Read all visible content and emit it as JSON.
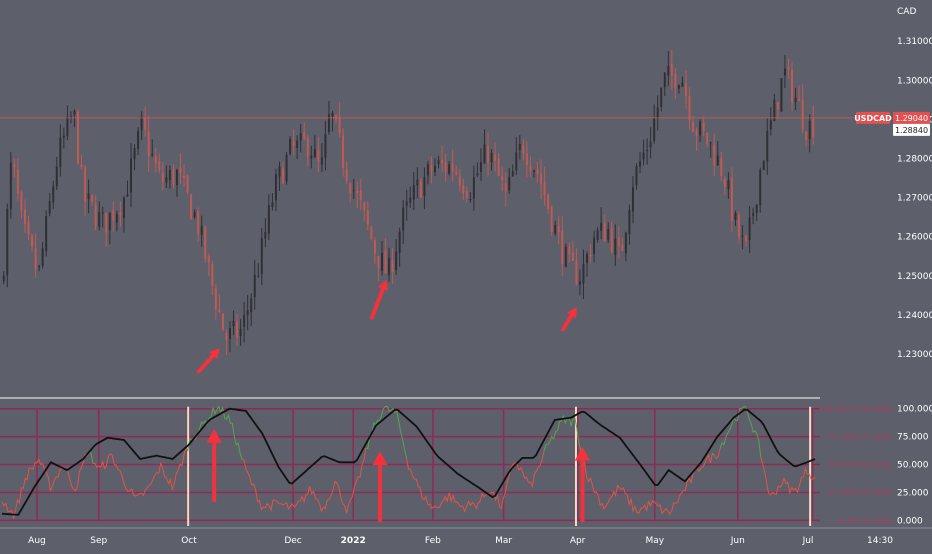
{
  "chart_data": [
    {
      "type": "candlestick",
      "symbol": "USDCAD",
      "currency_label": "CAD",
      "y_ticks": [
        1.23,
        1.24,
        1.25,
        1.26,
        1.27,
        1.28,
        1.29,
        1.3,
        1.31
      ],
      "y_tick_labels": [
        "1.23000",
        "1.24000",
        "1.25000",
        "1.26000",
        "1.27000",
        "1.28000",
        "1.29000",
        "1.30000",
        "1.31000"
      ],
      "ylim": [
        1.2195,
        1.3185
      ],
      "x_labels": [
        {
          "label": "Aug",
          "t": 0.043
        },
        {
          "label": "Sep",
          "t": 0.119
        },
        {
          "label": "Oct",
          "t": 0.23
        },
        {
          "label": "Dec",
          "t": 0.358
        },
        {
          "label": "2022",
          "t": 0.432
        },
        {
          "label": "Feb",
          "t": 0.53
        },
        {
          "label": "Mar",
          "t": 0.617
        },
        {
          "label": "Apr",
          "t": 0.708
        },
        {
          "label": "May",
          "t": 0.803
        },
        {
          "label": "Jun",
          "t": 0.905
        },
        {
          "label": "Jul",
          "t": 0.997
        }
      ],
      "anchors": [
        [
          0.0,
          1.248
        ],
        [
          0.012,
          1.28
        ],
        [
          0.025,
          1.262
        ],
        [
          0.045,
          1.25
        ],
        [
          0.068,
          1.28
        ],
        [
          0.088,
          1.292
        ],
        [
          0.1,
          1.27
        ],
        [
          0.125,
          1.263
        ],
        [
          0.15,
          1.27
        ],
        [
          0.172,
          1.288
        ],
        [
          0.195,
          1.274
        ],
        [
          0.215,
          1.276
        ],
        [
          0.24,
          1.264
        ],
        [
          0.258,
          1.248
        ],
        [
          0.275,
          1.234
        ],
        [
          0.295,
          1.236
        ],
        [
          0.315,
          1.252
        ],
        [
          0.335,
          1.272
        ],
        [
          0.355,
          1.282
        ],
        [
          0.378,
          1.284
        ],
        [
          0.392,
          1.276
        ],
        [
          0.404,
          1.292
        ],
        [
          0.422,
          1.278
        ],
        [
          0.44,
          1.268
        ],
        [
          0.46,
          1.256
        ],
        [
          0.475,
          1.25
        ],
        [
          0.492,
          1.264
        ],
        [
          0.51,
          1.272
        ],
        [
          0.532,
          1.278
        ],
        [
          0.555,
          1.278
        ],
        [
          0.575,
          1.272
        ],
        [
          0.598,
          1.282
        ],
        [
          0.62,
          1.27
        ],
        [
          0.64,
          1.284
        ],
        [
          0.66,
          1.276
        ],
        [
          0.68,
          1.262
        ],
        [
          0.697,
          1.252
        ],
        [
          0.712,
          1.25
        ],
        [
          0.728,
          1.26
        ],
        [
          0.745,
          1.262
        ],
        [
          0.76,
          1.254
        ],
        [
          0.775,
          1.274
        ],
        [
          0.795,
          1.284
        ],
        [
          0.815,
          1.3
        ],
        [
          0.835,
          1.302
        ],
        [
          0.852,
          1.288
        ],
        [
          0.87,
          1.284
        ],
        [
          0.888,
          1.276
        ],
        [
          0.903,
          1.262
        ],
        [
          0.915,
          1.256
        ],
        [
          0.935,
          1.28
        ],
        [
          0.95,
          1.292
        ],
        [
          0.962,
          1.302
        ],
        [
          0.975,
          1.296
        ],
        [
          0.99,
          1.288
        ],
        [
          1.0,
          1.289
        ]
      ],
      "last_price": 1.2904,
      "last_price_label": "1.29040",
      "prev_price": 1.2884,
      "prev_price_label": "1.28840",
      "annotations": [
        {
          "type": "arrow",
          "tip": [
            0.268,
            1.2315
          ],
          "tail": [
            0.242,
            1.2255
          ]
        },
        {
          "type": "arrow",
          "tip": [
            0.473,
            1.249
          ],
          "tail": [
            0.455,
            1.2393
          ]
        },
        {
          "type": "arrow",
          "tip": [
            0.707,
            1.242
          ],
          "tail": [
            0.69,
            1.2363
          ]
        }
      ],
      "colors": {
        "up": "#2f2f34",
        "down": "#c05a55",
        "price_line": "#d2595a",
        "badge": "#e0514f",
        "arrow": "#f2323c"
      }
    },
    {
      "type": "line",
      "y_ticks": [
        0,
        25,
        50,
        75,
        100
      ],
      "y_tick_labels": [
        "0.000",
        "25.000",
        "50.000",
        "75.000",
        "100.000"
      ],
      "level_labels": [
        "0.00%(0.000)",
        "25.00%(25.000)",
        "50.00%(50.000)",
        "75.00%(75.000)",
        "100.00%(100.000)"
      ],
      "ylim": [
        -5,
        106
      ],
      "series": [
        {
          "role": "black",
          "color": "#111111",
          "anchors": [
            [
              0.0,
              6
            ],
            [
              0.02,
              5
            ],
            [
              0.04,
              30
            ],
            [
              0.06,
              52
            ],
            [
              0.08,
              45
            ],
            [
              0.1,
              55
            ],
            [
              0.115,
              68
            ],
            [
              0.13,
              74
            ],
            [
              0.15,
              72
            ],
            [
              0.17,
              55
            ],
            [
              0.19,
              58
            ],
            [
              0.21,
              55
            ],
            [
              0.23,
              68
            ],
            [
              0.255,
              90
            ],
            [
              0.28,
              100
            ],
            [
              0.3,
              98
            ],
            [
              0.32,
              78
            ],
            [
              0.34,
              48
            ],
            [
              0.355,
              32
            ],
            [
              0.375,
              45
            ],
            [
              0.395,
              58
            ],
            [
              0.415,
              52
            ],
            [
              0.435,
              52
            ],
            [
              0.46,
              85
            ],
            [
              0.485,
              100
            ],
            [
              0.51,
              84
            ],
            [
              0.535,
              58
            ],
            [
              0.56,
              42
            ],
            [
              0.585,
              30
            ],
            [
              0.605,
              20
            ],
            [
              0.625,
              45
            ],
            [
              0.64,
              56
            ],
            [
              0.655,
              56
            ],
            [
              0.68,
              90
            ],
            [
              0.7,
              92
            ],
            [
              0.715,
              98
            ],
            [
              0.735,
              86
            ],
            [
              0.76,
              74
            ],
            [
              0.785,
              50
            ],
            [
              0.805,
              30
            ],
            [
              0.82,
              45
            ],
            [
              0.84,
              35
            ],
            [
              0.86,
              52
            ],
            [
              0.88,
              75
            ],
            [
              0.9,
              92
            ],
            [
              0.915,
              100
            ],
            [
              0.935,
              88
            ],
            [
              0.955,
              60
            ],
            [
              0.975,
              48
            ],
            [
              0.99,
              52
            ],
            [
              1.0,
              55
            ]
          ]
        },
        {
          "role": "fast",
          "color": "#e05448",
          "highlight_color": "#59a352",
          "highlight_above": 60,
          "anchors": [
            [
              0.0,
              18
            ],
            [
              0.015,
              5
            ],
            [
              0.03,
              40
            ],
            [
              0.045,
              55
            ],
            [
              0.06,
              30
            ],
            [
              0.075,
              50
            ],
            [
              0.09,
              28
            ],
            [
              0.105,
              62
            ],
            [
              0.12,
              45
            ],
            [
              0.135,
              58
            ],
            [
              0.15,
              35
            ],
            [
              0.165,
              18
            ],
            [
              0.18,
              28
            ],
            [
              0.195,
              48
            ],
            [
              0.21,
              30
            ],
            [
              0.23,
              70
            ],
            [
              0.25,
              88
            ],
            [
              0.265,
              102
            ],
            [
              0.28,
              90
            ],
            [
              0.3,
              45
            ],
            [
              0.32,
              12
            ],
            [
              0.34,
              15
            ],
            [
              0.36,
              10
            ],
            [
              0.38,
              28
            ],
            [
              0.395,
              10
            ],
            [
              0.41,
              35
            ],
            [
              0.425,
              8
            ],
            [
              0.44,
              40
            ],
            [
              0.455,
              80
            ],
            [
              0.47,
              101
            ],
            [
              0.485,
              96
            ],
            [
              0.5,
              50
            ],
            [
              0.515,
              25
            ],
            [
              0.53,
              10
            ],
            [
              0.55,
              22
            ],
            [
              0.565,
              12
            ],
            [
              0.585,
              15
            ],
            [
              0.6,
              28
            ],
            [
              0.615,
              12
            ],
            [
              0.63,
              55
            ],
            [
              0.65,
              30
            ],
            [
              0.67,
              65
            ],
            [
              0.69,
              90
            ],
            [
              0.705,
              88
            ],
            [
              0.72,
              40
            ],
            [
              0.74,
              12
            ],
            [
              0.76,
              30
            ],
            [
              0.78,
              8
            ],
            [
              0.8,
              15
            ],
            [
              0.82,
              6
            ],
            [
              0.84,
              28
            ],
            [
              0.86,
              50
            ],
            [
              0.88,
              60
            ],
            [
              0.9,
              90
            ],
            [
              0.915,
              102
            ],
            [
              0.93,
              70
            ],
            [
              0.945,
              20
            ],
            [
              0.96,
              35
            ],
            [
              0.975,
              25
            ],
            [
              0.99,
              45
            ],
            [
              1.0,
              38
            ]
          ]
        }
      ],
      "annotations": [
        {
          "type": "vline",
          "x": 0.229,
          "color": "#f3dcc3"
        },
        {
          "type": "vline",
          "x": 0.706,
          "color": "#f3dcc3"
        },
        {
          "type": "vline",
          "x": 0.994,
          "color": "#f3dcc3"
        },
        {
          "type": "arrow-up",
          "x": 0.261,
          "tip": 82,
          "tail": 18
        },
        {
          "type": "arrow-up",
          "x": 0.465,
          "tip": 62,
          "tail": 0
        },
        {
          "type": "arrow-up",
          "x": 0.714,
          "tip": 66,
          "tail": 0
        }
      ],
      "colors": {
        "grid": "#8e2a53",
        "level_text": "#a0405d",
        "arrow": "#f2323c"
      }
    }
  ],
  "time_label": "14:30"
}
